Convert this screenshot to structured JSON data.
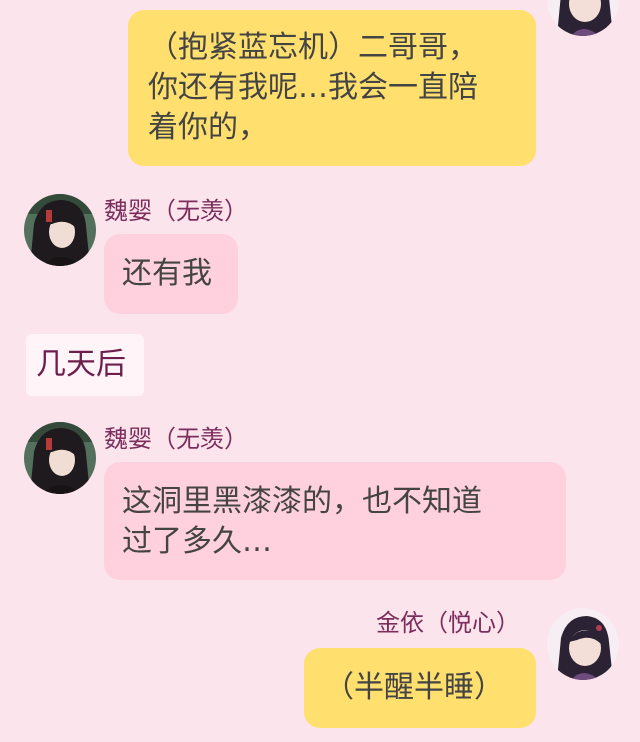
{
  "messages": [
    {
      "side": "right",
      "text": "（抱紧蓝忘机）二哥哥，\n你还有我呢…我会一直陪\n着你的，",
      "avatar_icon": "jin-ling-avatar-icon"
    },
    {
      "side": "left",
      "sender": "魏婴（无羡）",
      "text": "还有我",
      "avatar_icon": "wei-ying-avatar-icon"
    },
    {
      "type": "narration",
      "text": "几天后"
    },
    {
      "side": "left",
      "sender": "魏婴（无羡）",
      "text": "这洞里黑漆漆的，也不知道\n过了多久…",
      "avatar_icon": "wei-ying-avatar-icon"
    },
    {
      "side": "right",
      "sender": "金依（悦心）",
      "text": "（半醒半睡）",
      "avatar_icon": "jin-ling-avatar-icon"
    }
  ],
  "colors": {
    "background": "#fce4ec",
    "right_bubble": "#ffdf6e",
    "left_bubble": "#ffd0de",
    "sender_name": "#7b2d5b",
    "narration_text": "#6d1f4c"
  }
}
